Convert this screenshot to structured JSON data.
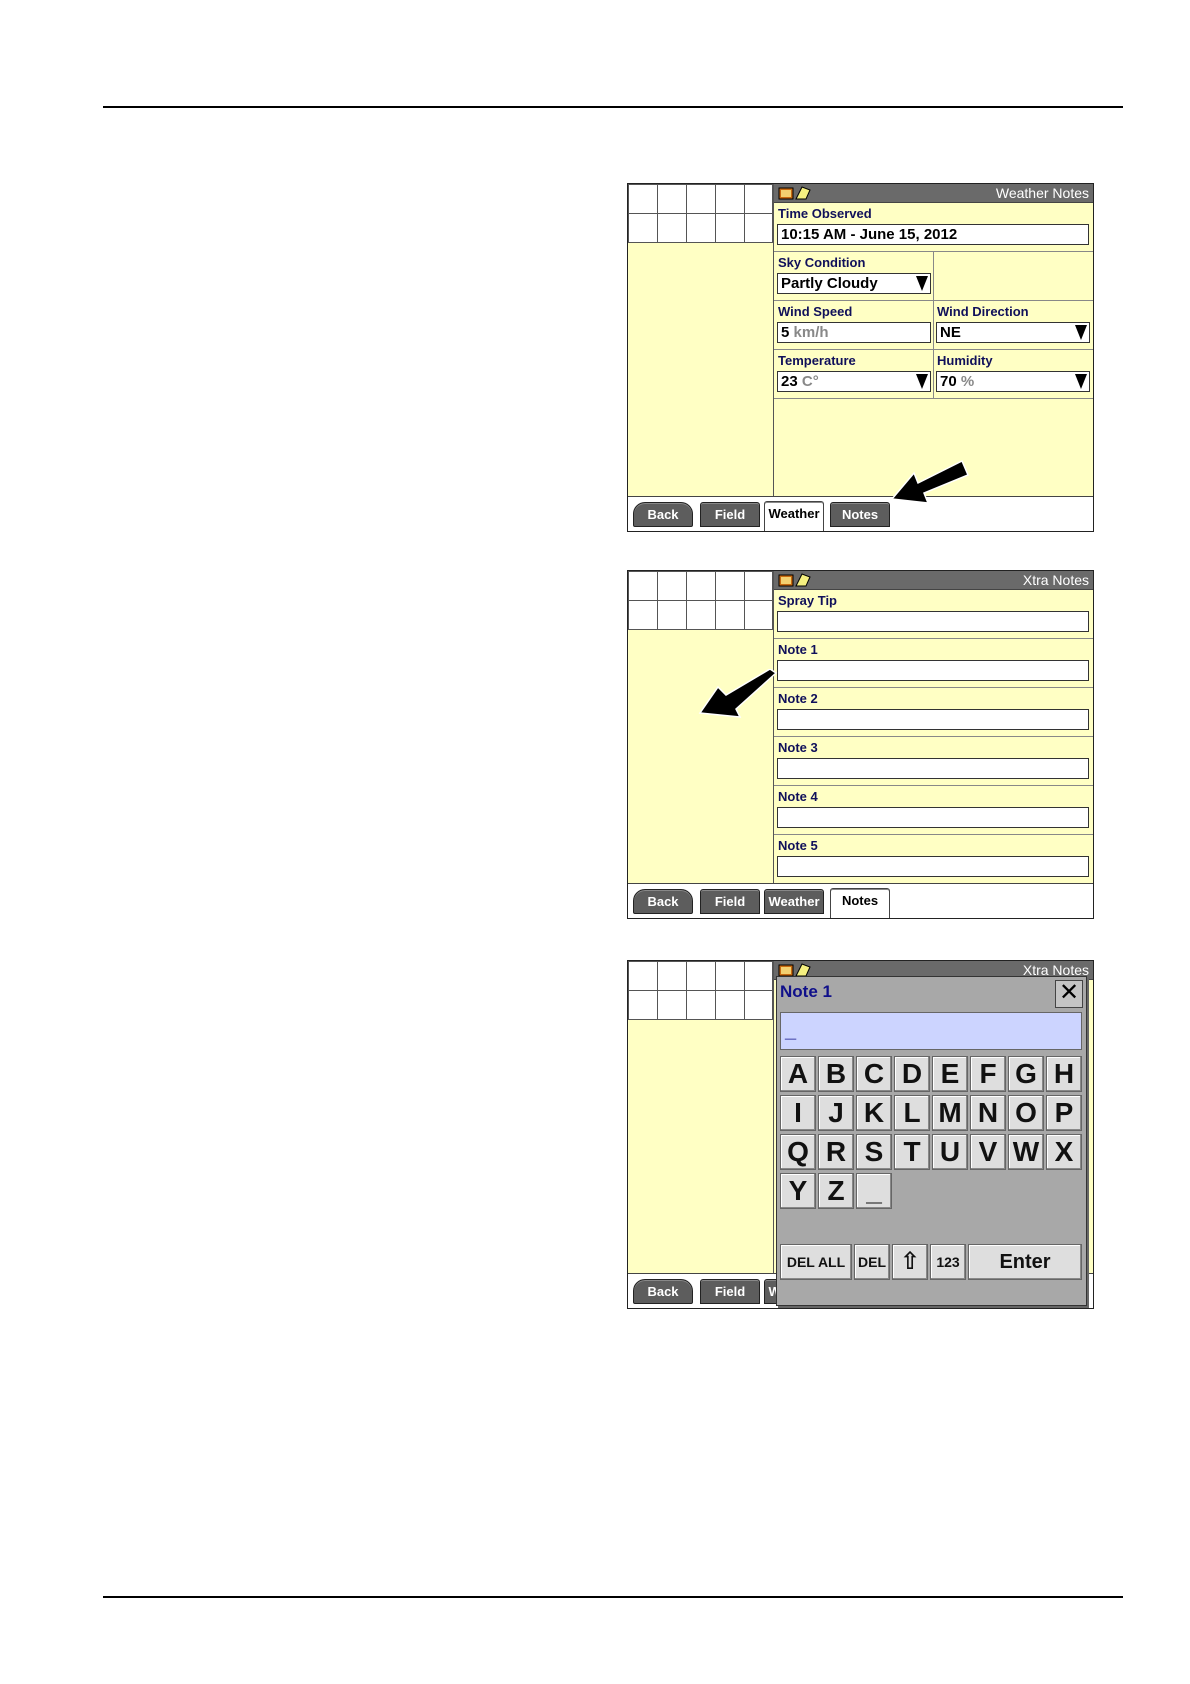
{
  "weather_screen": {
    "title": "Weather Notes",
    "time_observed_label": "Time Observed",
    "time_observed_value": "10:15 AM - June 15, 2012",
    "sky_condition_label": "Sky Condition",
    "sky_condition_value": "Partly Cloudy",
    "wind_speed_label": "Wind Speed",
    "wind_speed_value": "5",
    "wind_speed_unit": "km/h",
    "wind_direction_label": "Wind Direction",
    "wind_direction_value": "NE",
    "temperature_label": "Temperature",
    "temperature_value": "23",
    "temperature_unit": "C°",
    "humidity_label": "Humidity",
    "humidity_value": "70",
    "humidity_unit": "%"
  },
  "notes_screen": {
    "title": "Xtra Notes",
    "spray_tip_label": "Spray Tip",
    "note_labels": [
      "Note 1",
      "Note 2",
      "Note 3",
      "Note 4",
      "Note 5"
    ]
  },
  "keyboard_screen": {
    "title": "Xtra Notes",
    "dialog_title": "Note 1",
    "close_glyph": "✕",
    "input_value": "_",
    "keys": [
      "A",
      "B",
      "C",
      "D",
      "E",
      "F",
      "G",
      "H",
      "I",
      "J",
      "K",
      "L",
      "M",
      "N",
      "O",
      "P",
      "Q",
      "R",
      "S",
      "T",
      "U",
      "V",
      "W",
      "X",
      "Y",
      "Z",
      "_"
    ],
    "del_all_label": "DEL ALL",
    "del_label": "DEL",
    "shift_glyph": "⇧",
    "num_label": "123",
    "enter_label": "Enter"
  },
  "tabs": {
    "back": "Back",
    "field": "Field",
    "weather": "Weather",
    "notes": "Notes"
  },
  "icons": [
    "display-icon",
    "notebook-icon",
    "dropdown-arrow-icon",
    "pointer-arrow-icon"
  ]
}
